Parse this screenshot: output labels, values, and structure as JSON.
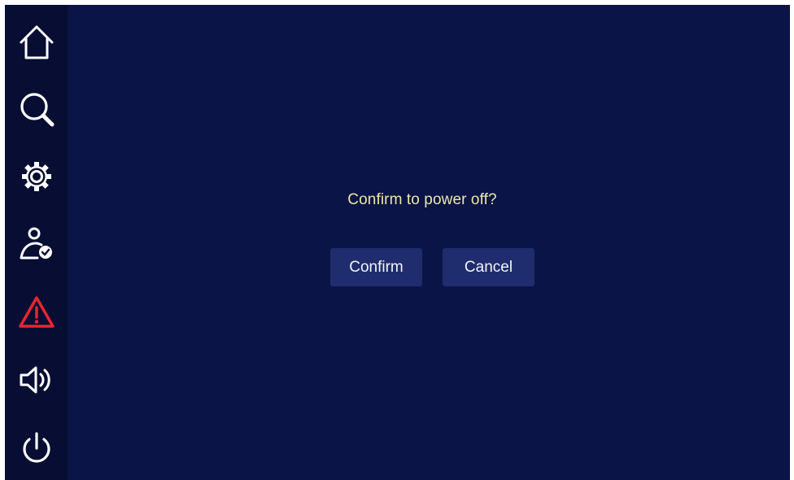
{
  "sidebar": {
    "items": [
      {
        "icon": "home-icon",
        "color": "#ffffff"
      },
      {
        "icon": "search-icon",
        "color": "#ffffff"
      },
      {
        "icon": "gear-icon",
        "color": "#ffffff"
      },
      {
        "icon": "user-check-icon",
        "color": "#ffffff"
      },
      {
        "icon": "warning-icon",
        "color": "#e8262e"
      },
      {
        "icon": "speaker-icon",
        "color": "#ffffff"
      },
      {
        "icon": "power-icon",
        "color": "#ffffff"
      }
    ]
  },
  "dialog": {
    "message": "Confirm to power off?",
    "confirm_label": "Confirm",
    "cancel_label": "Cancel"
  },
  "colors": {
    "background": "#0a1446",
    "sidebar": "#070d33",
    "button": "#1f2d6e",
    "message_text": "#ece7a4",
    "alert": "#e8262e"
  }
}
